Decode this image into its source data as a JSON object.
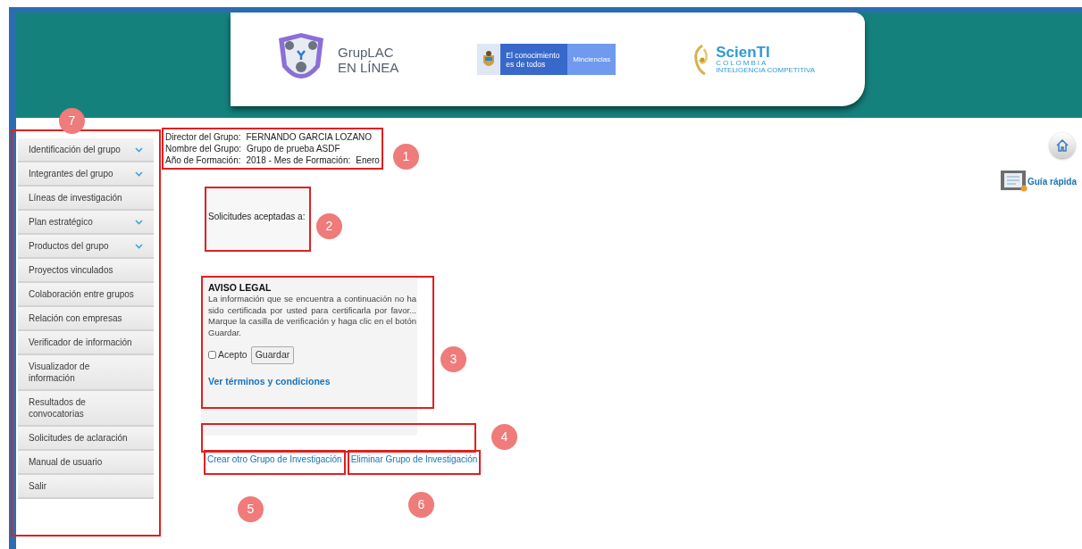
{
  "header": {
    "app_logo": {
      "line1": "GrupLAC",
      "line2": "EN LÍNEA"
    },
    "gov_logo": {
      "slogan": "El conocimiento es de todos",
      "ministry": "Minciencias"
    },
    "scienti_logo": {
      "name": "ScienTI",
      "country": "COLOMBIA",
      "tagline": "INTELIGENCIA COMPETITIVA"
    }
  },
  "sidebar": {
    "items": [
      {
        "label": "Identificación del grupo",
        "expandable": true
      },
      {
        "label": "Integrantes del grupo",
        "expandable": true
      },
      {
        "label": "Líneas de investigación",
        "expandable": false
      },
      {
        "label": "Plan estratégico",
        "expandable": true
      },
      {
        "label": "Productos del grupo",
        "expandable": true
      },
      {
        "label": "Proyectos vinculados",
        "expandable": false
      },
      {
        "label": "Colaboración entre grupos",
        "expandable": false
      },
      {
        "label": "Relación con empresas",
        "expandable": false
      },
      {
        "label": "Verificador de información",
        "expandable": false
      },
      {
        "label": "Visualizador de información",
        "expandable": false
      },
      {
        "label": "Resultados de convocatorias",
        "expandable": false
      },
      {
        "label": "Solicitudes de aclaración",
        "expandable": false
      },
      {
        "label": "Manual de usuario",
        "expandable": false
      },
      {
        "label": "Salir",
        "expandable": false
      }
    ]
  },
  "group_info": {
    "rows": [
      [
        "Director del Grupo:",
        "FERNANDO GARCIA LOZANO"
      ],
      [
        "Nombre del Grupo:",
        "Grupo de prueba ASDF"
      ],
      [
        "Año de Formación:",
        "2018 - Mes de Formación:",
        "Enero"
      ]
    ]
  },
  "requests": {
    "label": "Solicitudes aceptadas a:"
  },
  "legal_notice": {
    "title": "AVISO LEGAL",
    "text": "La información que se encuentra a continuación no ha sido certificada por usted para certificarla por favor... Marque la casilla de verificación y haga clic en el botón Guardar.",
    "checkbox": {
      "label": "Acepto",
      "checked": false
    },
    "button": "Guardar",
    "link": "Ver términos y condiciones"
  },
  "links": [
    "Crear otro Grupo de Investigación",
    "Eliminar Grupo de Investigación"
  ],
  "quick_guide": {
    "label": "Guía rápida"
  },
  "annotations": [
    "1",
    "2",
    "3",
    "4",
    "5",
    "6",
    "7"
  ]
}
